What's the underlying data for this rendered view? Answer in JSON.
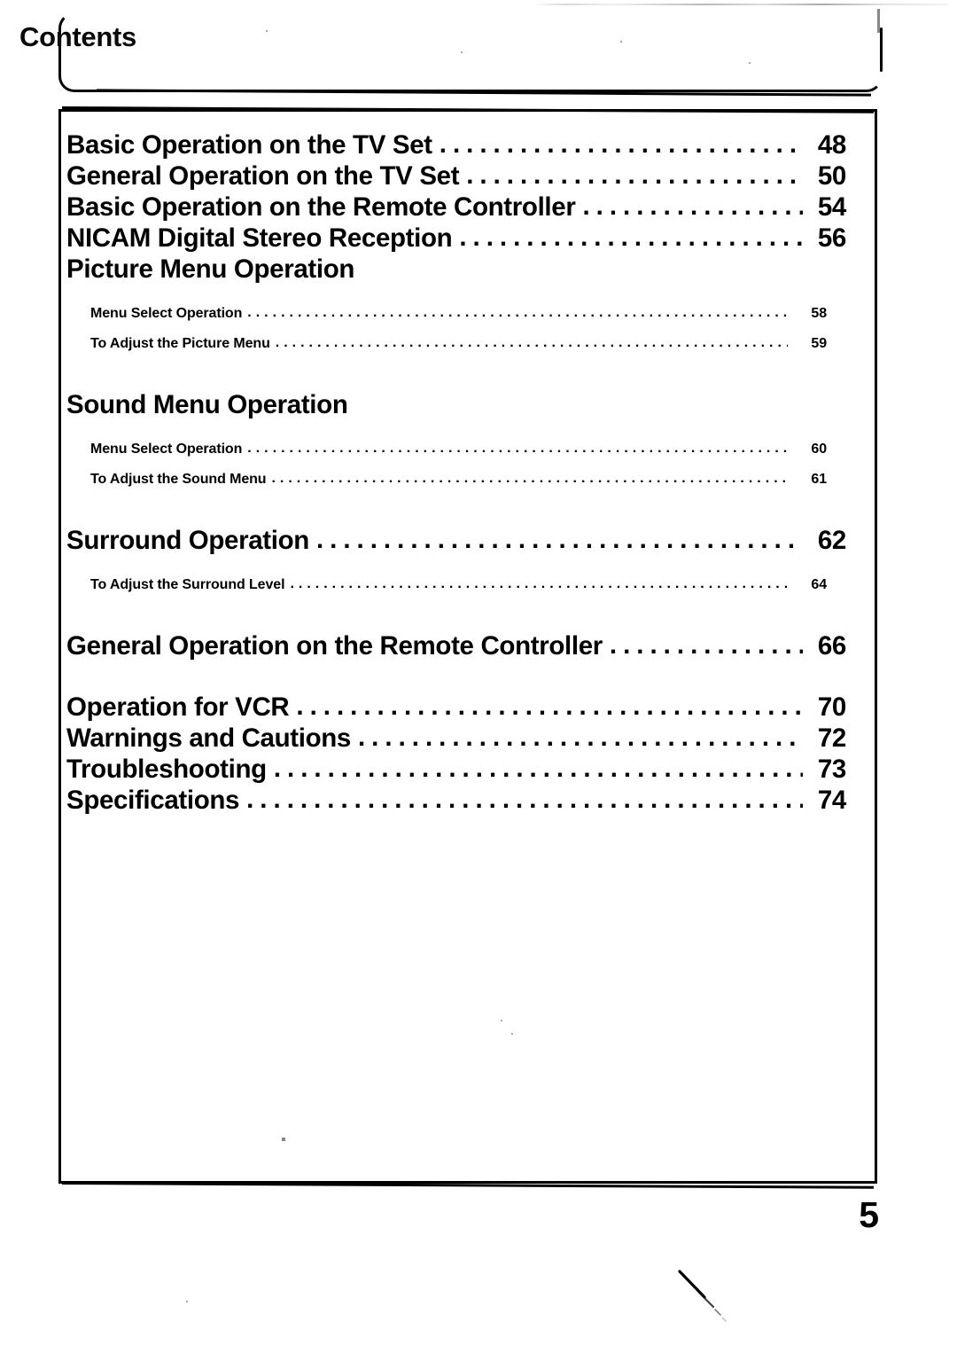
{
  "header": {
    "title": "Contents"
  },
  "toc": {
    "entries": [
      {
        "level": 1,
        "label": "Basic Operation on the TV Set",
        "page": "48",
        "leader": true,
        "gap_before": "none"
      },
      {
        "level": 1,
        "label": "General Operation on the TV Set",
        "page": "50",
        "leader": true,
        "gap_before": "none"
      },
      {
        "level": 1,
        "label": "Basic Operation on the Remote Controller",
        "page": "54",
        "leader": true,
        "gap_before": "none"
      },
      {
        "level": 1,
        "label": "NICAM Digital Stereo Reception",
        "page": "56",
        "leader": true,
        "gap_before": "none"
      },
      {
        "level": 1,
        "label": "Picture Menu Operation",
        "page": "",
        "leader": false,
        "gap_before": "none"
      },
      {
        "level": 2,
        "label": "Menu Select Operation",
        "page": "58",
        "leader": true,
        "gap_before": "sm"
      },
      {
        "level": 2,
        "label": "To Adjust the Picture Menu",
        "page": "59",
        "leader": true,
        "gap_before": "none"
      },
      {
        "level": 1,
        "label": "Sound Menu Operation",
        "page": "",
        "leader": false,
        "gap_before": "lg"
      },
      {
        "level": 2,
        "label": "Menu Select Operation",
        "page": "60",
        "leader": true,
        "gap_before": "sm"
      },
      {
        "level": 2,
        "label": "To Adjust the Sound Menu",
        "page": "61",
        "leader": true,
        "gap_before": "none"
      },
      {
        "level": 1,
        "label": "Surround Operation",
        "page": "62",
        "leader": true,
        "gap_before": "lg"
      },
      {
        "level": 2,
        "label": "To Adjust the Surround Level",
        "page": "64",
        "leader": true,
        "gap_before": "sm"
      },
      {
        "level": 1,
        "label": "General Operation on the Remote Controller",
        "page": "66",
        "leader": true,
        "gap_before": "lg"
      },
      {
        "level": 1,
        "label": "Operation for VCR",
        "page": "70",
        "leader": true,
        "gap_before": "lg"
      },
      {
        "level": 1,
        "label": "Warnings and Cautions",
        "page": "72",
        "leader": true,
        "gap_before": "none"
      },
      {
        "level": 1,
        "label": "Troubleshooting",
        "page": "73",
        "leader": true,
        "gap_before": "none"
      },
      {
        "level": 1,
        "label": "Specifications",
        "page": "74",
        "leader": true,
        "gap_before": "none"
      }
    ],
    "leader_dots_major": "................................................",
    "leader_dots_minor": "................................................................................"
  },
  "footer": {
    "page_number": "5"
  }
}
